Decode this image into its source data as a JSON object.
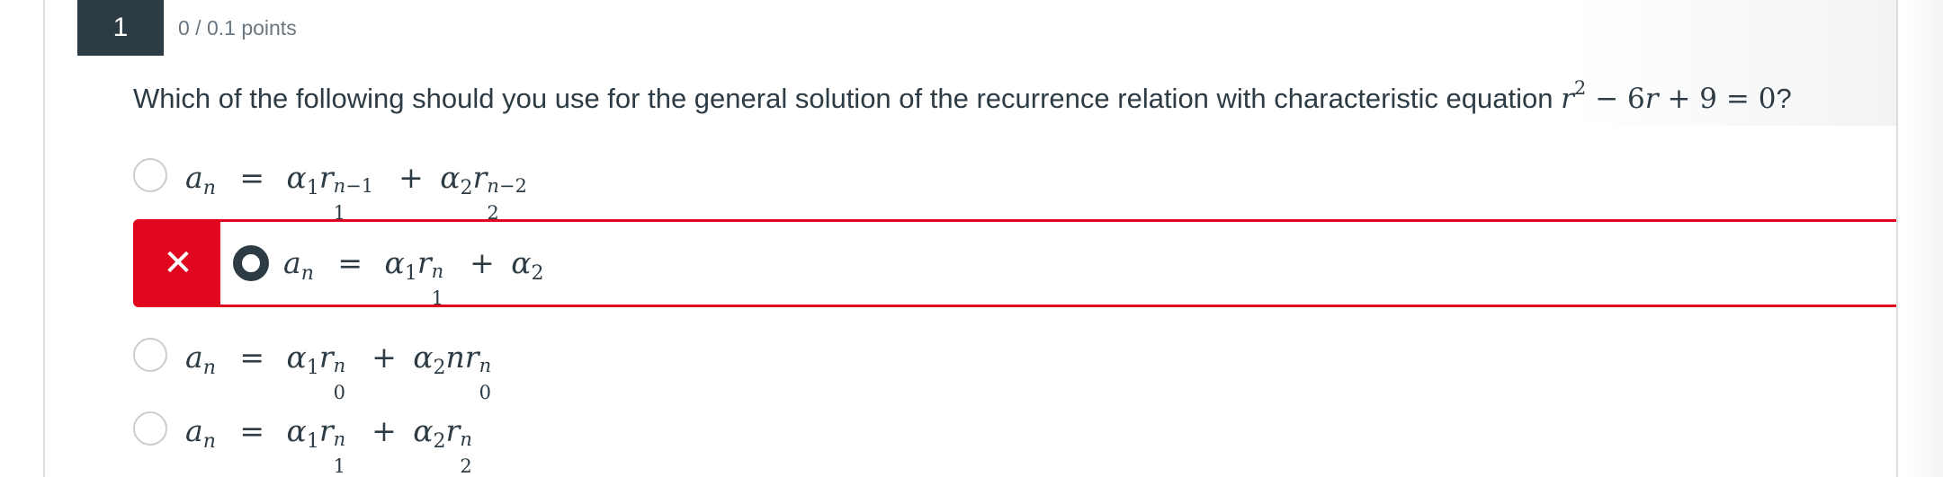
{
  "question": {
    "number": "1",
    "points": "0 / 0.1 points",
    "text": "Which of the following should you use for the general solution of the recurrence relation with characteristic equation",
    "equation_end": "?"
  },
  "options": [
    {
      "id": "a",
      "state": "unselected",
      "formula": "a_n = α_1 r_1^{n-1} + α_2 r_2^{n-2}"
    },
    {
      "id": "b",
      "state": "selected-incorrect",
      "formula": "a_n = α_1 r_1^n + α_2"
    },
    {
      "id": "c",
      "state": "unselected",
      "formula": "a_n = α_1 r_0^n + α_2 n r_0^n"
    },
    {
      "id": "d",
      "state": "unselected",
      "formula": "a_n = α_1 r_1^n + α_2 r_2^n"
    }
  ],
  "incorrect_mark": "✕",
  "colors": {
    "header_bg": "#2d3b45",
    "error_red": "#e0061f",
    "text": "#2d3b45",
    "muted": "#6b7780",
    "radio_border": "#c7cdd1"
  },
  "icons": {
    "incorrect": "close-icon",
    "radio": "radio-button"
  }
}
